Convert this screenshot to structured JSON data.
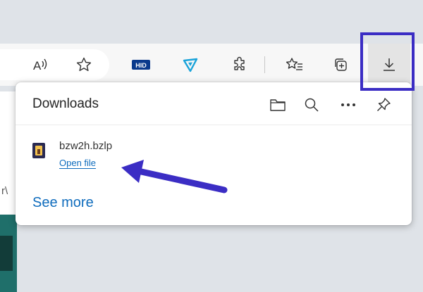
{
  "toolbar": {
    "icons": [
      {
        "name": "read-aloud-icon",
        "glyph": "A⁾"
      },
      {
        "name": "favorite-star-icon"
      },
      {
        "name": "hid-extension-icon",
        "label": "HID"
      },
      {
        "name": "shield-extension-icon"
      },
      {
        "name": "extensions-icon"
      },
      {
        "name": "favorites-icon"
      },
      {
        "name": "collections-icon"
      },
      {
        "name": "downloads-icon"
      }
    ]
  },
  "downloads_panel": {
    "title": "Downloads",
    "items": [
      {
        "file_name": "bzw2h.bzlp",
        "action_label": "Open file"
      }
    ],
    "see_more_label": "See more"
  },
  "colors": {
    "highlight": "#3b2dc4",
    "link": "#0f6cbd",
    "toolbar_bg": "#f7f7f7"
  }
}
